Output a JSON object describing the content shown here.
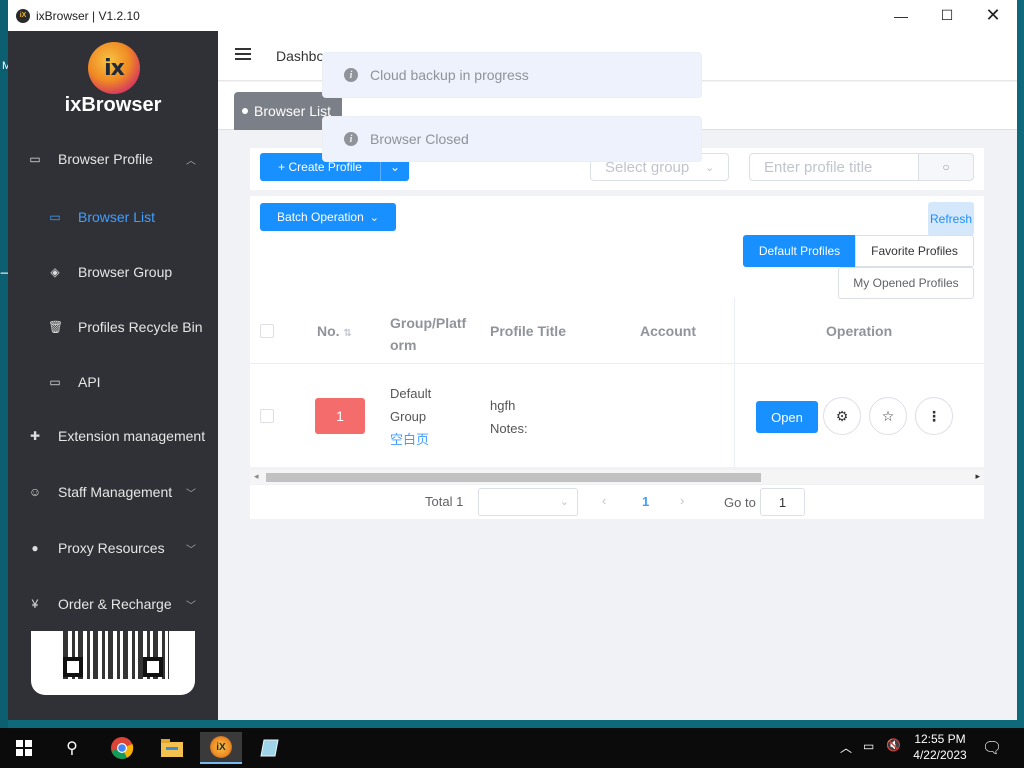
{
  "window": {
    "title": "ixBrowser | V1.2.10",
    "app_icon_text": "iX"
  },
  "desktop": {
    "label": "M"
  },
  "sidebar": {
    "logo_text": "ix",
    "brand": "ixBrowser",
    "items": [
      {
        "label": "Browser Profile",
        "icon": "browser-profile-icon",
        "chevron": "^"
      },
      {
        "label": "Browser List",
        "icon": "browser-list-icon"
      },
      {
        "label": "Browser Group",
        "icon": "layers-icon"
      },
      {
        "label": "Profiles Recycle Bin",
        "icon": "trash-icon"
      },
      {
        "label": "API",
        "icon": "api-icon"
      },
      {
        "label": "Extension management",
        "icon": "puzzle-icon"
      },
      {
        "label": "Staff Management",
        "icon": "user-icon",
        "chevron": "v"
      },
      {
        "label": "Proxy Resources",
        "icon": "globe-icon",
        "chevron": "v"
      },
      {
        "label": "Order & Recharge",
        "icon": "yen-icon",
        "chevron": "v"
      }
    ]
  },
  "header": {
    "breadcrumb": "Dashbo"
  },
  "tabs": {
    "active": "Browser List"
  },
  "notifications": [
    {
      "text": "Cloud backup in progress"
    },
    {
      "text": "Browser Closed"
    }
  ],
  "toolbar": {
    "create_profile": "+ Create Profile",
    "group_placeholder": "Select group",
    "title_placeholder": "Enter profile title",
    "batch_operation": "Batch Operation",
    "refresh": "Refresh"
  },
  "filters": {
    "default_profiles": "Default Profiles",
    "favorite_profiles": "Favorite Profiles",
    "my_opened_profiles": "My Opened Profiles"
  },
  "table": {
    "headers": [
      "No.",
      "Group/Platf",
      "orm",
      "Profile Title",
      "Account",
      "Operation"
    ],
    "rows": [
      {
        "no": "1",
        "group_line1": "Default",
        "group_line2": "Group",
        "platform": "空白页",
        "title": "hgfh",
        "notes": "Notes:",
        "open": "Open"
      }
    ]
  },
  "pagination": {
    "total": "Total 1",
    "current": "1",
    "goto_label": "Go to",
    "goto_value": "1"
  },
  "taskbar": {
    "time": "12:55 PM",
    "date": "4/22/2023"
  },
  "colors": {
    "accent": "#1890ff",
    "sidebar_bg": "#2f3136",
    "badge_red": "#f56c6c"
  }
}
